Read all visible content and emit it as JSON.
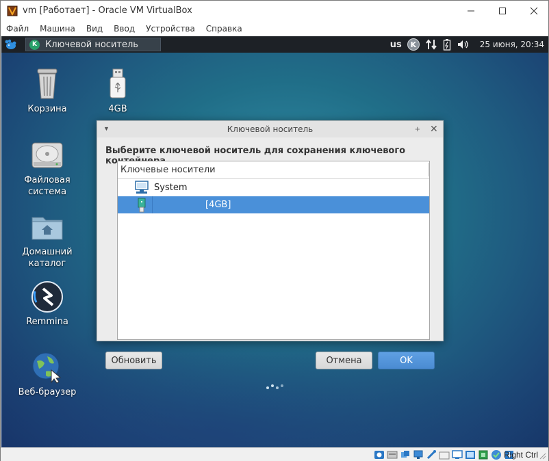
{
  "vbox": {
    "title": "vm [Работает] - Oracle VM VirtualBox",
    "menu": [
      "Файл",
      "Машина",
      "Вид",
      "Ввод",
      "Устройства",
      "Справка"
    ],
    "window_controls": {
      "minimize": "—",
      "maximize": "☐",
      "close": "✕"
    }
  },
  "panel": {
    "task_label": "Ключевой носитель",
    "task_badge": "K",
    "keyboard_layout": "us",
    "tray_badge": "K",
    "clock": "25 июня, 20:34"
  },
  "desktop": {
    "icons": [
      {
        "label": "Корзина",
        "icon": "trash-icon"
      },
      {
        "label": "4GB",
        "icon": "usb-drive-icon"
      },
      {
        "label": "Файловая система",
        "icon": "hard-drive-icon"
      },
      {
        "label": "Домашний каталог",
        "icon": "home-folder-icon"
      },
      {
        "label": "Remmina",
        "icon": "remmina-icon"
      },
      {
        "label": "Веб-браузер",
        "icon": "web-browser-icon"
      }
    ]
  },
  "dialog": {
    "title": "Ключевой носитель",
    "heading": "Выберите ключевой носитель для сохранения ключевого контейнера",
    "column_header": "Ключевые носители",
    "rows": [
      {
        "label": "System",
        "icon": "computer-icon",
        "selected": false
      },
      {
        "label": "[4GB]",
        "icon": "usb-token-icon",
        "selected": true
      }
    ],
    "buttons": {
      "refresh": "Обновить",
      "cancel": "Отмена",
      "ok": "OK"
    }
  },
  "statusbar": {
    "host_key": "Right Ctrl"
  },
  "colors": {
    "panel_bg": "#1d2126",
    "selection": "#4a90d9",
    "ok_button": "#4a8bd2",
    "desktop_bg": "#206e88"
  }
}
